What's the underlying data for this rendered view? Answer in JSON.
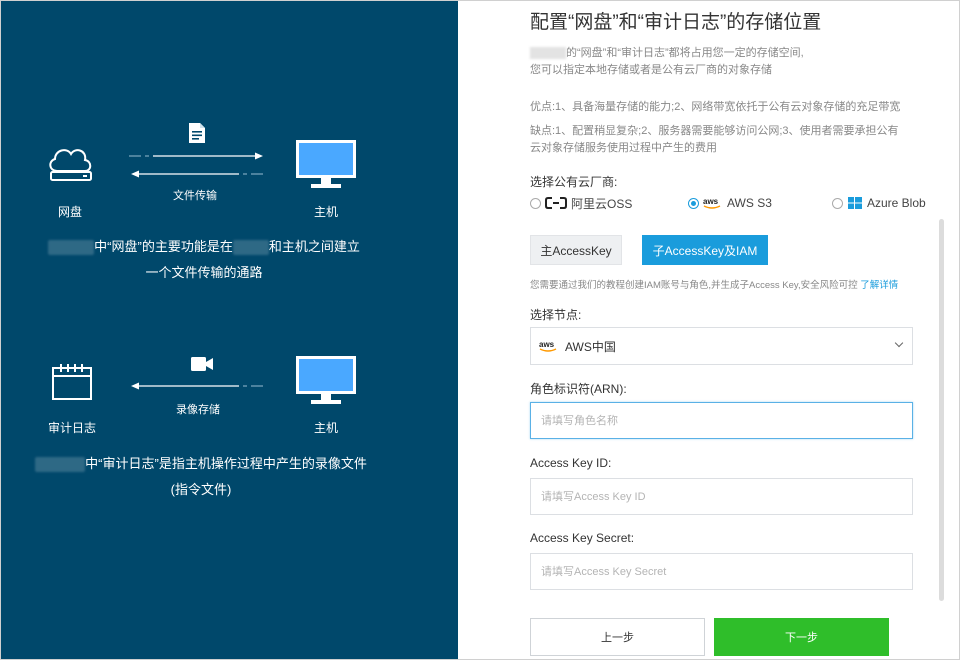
{
  "left": {
    "diagram1": {
      "source_label": "网盘",
      "target_label": "主机",
      "arrow_label": "文件传输",
      "desc_line1_mid": "中“网盘”的主要功能是在",
      "desc_line1_end": "和主机之间建立",
      "desc_line2": "一个文件传输的通路"
    },
    "diagram2": {
      "source_label": "审计日志",
      "target_label": "主机",
      "arrow_label": "录像存储",
      "desc_line1_mid": "中“审计日志”是指主机操作过程中产生的录像文件",
      "desc_line2": "(指令文件)"
    }
  },
  "right": {
    "title": "配置“网盘”和“审计日志”的存储位置",
    "intro_line1": "的“网盘”和“审计日志”都将占用您一定的存储空间,",
    "intro_line2": "您可以指定本地存储或者是公有云厂商的对象存储",
    "pros": "优点:1、具备海量存储的能力;2、网络带宽依托于公有云对象存储的充足带宽",
    "cons_line1": "缺点:1、配置稍显复杂;2、服务器需要能够访问公网;3、使用者需要承担公有",
    "cons_line2": "云对象存储服务使用过程中产生的费用",
    "vendor_label": "选择公有云厂商:",
    "vendors": [
      "阿里云OSS",
      "AWS S3",
      "Azure Blob"
    ],
    "selected_vendor": "AWS S3",
    "key_tabs": [
      "主AccessKey",
      "子AccessKey及IAM"
    ],
    "active_key_tab": "子AccessKey及IAM",
    "hint": "您需要通过我们的教程创建IAM账号与角色,并生成子Access Key,安全风险可控",
    "hint_link": "了解详情",
    "node_label": "选择节点:",
    "node_value": "AWS中国",
    "arn_label": "角色标识符(ARN):",
    "arn_placeholder": "请填写角色名称",
    "key_id_label": "Access Key ID:",
    "key_id_placeholder": "请填写Access Key ID",
    "key_secret_label": "Access Key Secret:",
    "key_secret_placeholder": "请填写Access Key Secret",
    "prev_button": "上一步",
    "next_button": "下一步"
  },
  "colors": {
    "left_bg": "#00486b",
    "accent": "#1a9cdc",
    "next_button": "#2fbe2a",
    "monitor": "#4aa8ff"
  }
}
